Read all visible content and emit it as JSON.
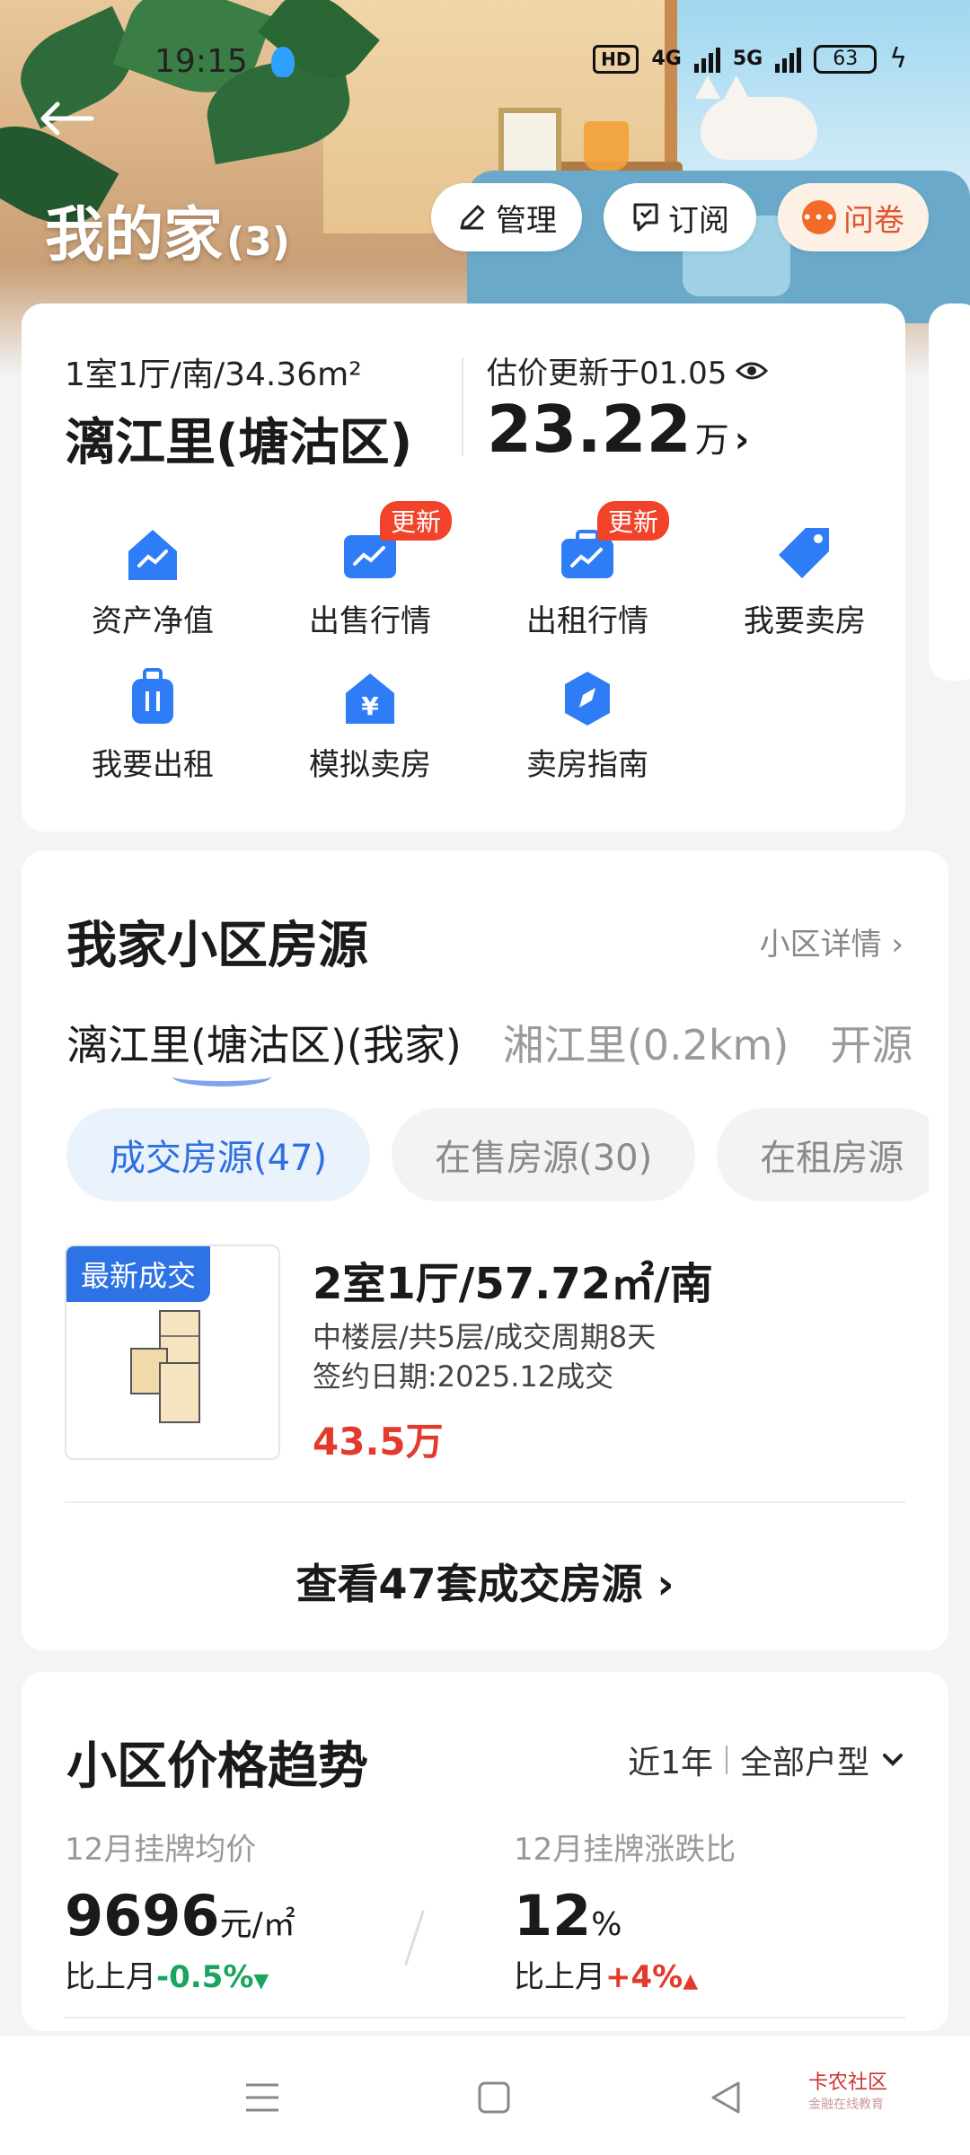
{
  "status_bar": {
    "time": "19:15",
    "hd_label": "HD",
    "net1": "4G",
    "net2": "5G",
    "battery": "63"
  },
  "header": {
    "title": "我的家",
    "count": "(3)",
    "buttons": {
      "manage": "管理",
      "subscribe": "订阅",
      "survey": "问卷",
      "survey_icon_text": "•••"
    }
  },
  "home_card": {
    "spec": "1室1厅/南/34.36m²",
    "name": "漓江里(塘沽区)",
    "estimate_label": "估价更新于01.05",
    "estimate_value": "23.22",
    "estimate_unit": "万",
    "grid": [
      {
        "label": "资产净值",
        "icon": "house-chart-icon",
        "badge": ""
      },
      {
        "label": "出售行情",
        "icon": "sale-chart-icon",
        "badge": "更新"
      },
      {
        "label": "出租行情",
        "icon": "rent-chart-icon",
        "badge": "更新"
      },
      {
        "label": "我要卖房",
        "icon": "tag-icon",
        "badge": ""
      },
      {
        "label": "我要出租",
        "icon": "luggage-icon",
        "badge": ""
      },
      {
        "label": "模拟卖房",
        "icon": "yuan-house-icon",
        "badge": ""
      },
      {
        "label": "卖房指南",
        "icon": "compass-icon",
        "badge": ""
      }
    ]
  },
  "listing_section": {
    "title": "我家小区房源",
    "detail_link": "小区详情 ›",
    "community_tabs": [
      "漓江里(塘沽区)(我家)",
      "湘江里(0.2km)",
      "开源"
    ],
    "chips": [
      "成交房源(47)",
      "在售房源(30)",
      "在租房源"
    ],
    "listing": {
      "badge": "最新成交",
      "title": "2室1厅/57.72㎡/南",
      "line1": "中楼层/共5层/成交周期8天",
      "line2": "签约日期:2025.12成交",
      "price": "43.5万"
    },
    "view_all": "查看47套成交房源 ›"
  },
  "trend_section": {
    "title": "小区价格趋势",
    "filter_period": "近1年",
    "filter_type": "全部户型",
    "stats": [
      {
        "label": "12月挂牌均价",
        "value": "9696",
        "unit": "元/㎡",
        "cmp_prefix": "比上月",
        "cmp_value": "-0.5%",
        "arrow": "▼"
      },
      {
        "label": "12月挂牌涨跌比",
        "value": "12",
        "unit": "%",
        "cmp_prefix": "比上月",
        "cmp_value": "+4%",
        "arrow": "▲"
      }
    ]
  },
  "watermark": {
    "line1": "卡农社区",
    "line2": "金融在线教育"
  },
  "colors": {
    "accent_blue": "#2f6fe0",
    "price_red": "#e23b2d",
    "down_green": "#19a560",
    "badge_red": "#f0432a",
    "survey_orange": "#f26b2a"
  }
}
